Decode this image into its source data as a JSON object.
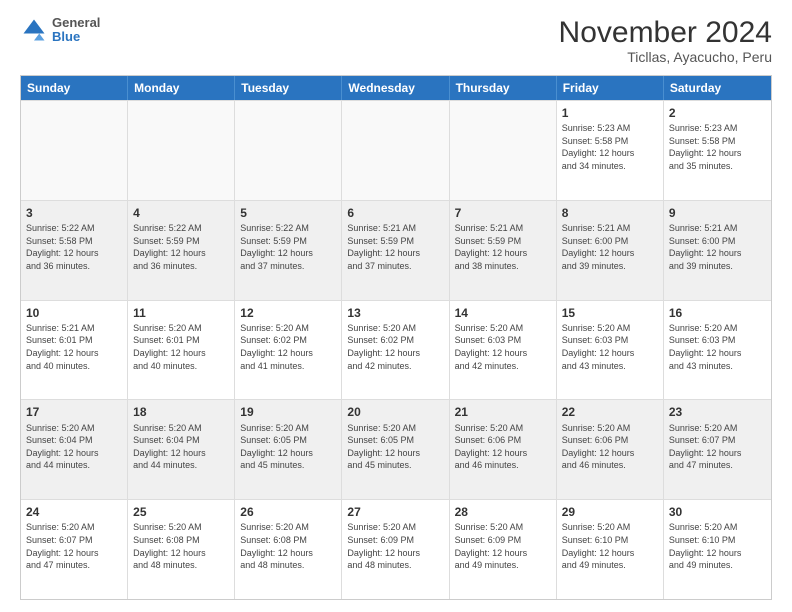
{
  "header": {
    "logo": {
      "line1": "General",
      "line2": "Blue"
    },
    "title": "November 2024",
    "subtitle": "Ticllas, Ayacucho, Peru"
  },
  "calendar": {
    "days": [
      "Sunday",
      "Monday",
      "Tuesday",
      "Wednesday",
      "Thursday",
      "Friday",
      "Saturday"
    ],
    "rows": [
      [
        {
          "day": "",
          "text": ""
        },
        {
          "day": "",
          "text": ""
        },
        {
          "day": "",
          "text": ""
        },
        {
          "day": "",
          "text": ""
        },
        {
          "day": "",
          "text": ""
        },
        {
          "day": "1",
          "text": "Sunrise: 5:23 AM\nSunset: 5:58 PM\nDaylight: 12 hours\nand 34 minutes."
        },
        {
          "day": "2",
          "text": "Sunrise: 5:23 AM\nSunset: 5:58 PM\nDaylight: 12 hours\nand 35 minutes."
        }
      ],
      [
        {
          "day": "3",
          "text": "Sunrise: 5:22 AM\nSunset: 5:58 PM\nDaylight: 12 hours\nand 36 minutes."
        },
        {
          "day": "4",
          "text": "Sunrise: 5:22 AM\nSunset: 5:59 PM\nDaylight: 12 hours\nand 36 minutes."
        },
        {
          "day": "5",
          "text": "Sunrise: 5:22 AM\nSunset: 5:59 PM\nDaylight: 12 hours\nand 37 minutes."
        },
        {
          "day": "6",
          "text": "Sunrise: 5:21 AM\nSunset: 5:59 PM\nDaylight: 12 hours\nand 37 minutes."
        },
        {
          "day": "7",
          "text": "Sunrise: 5:21 AM\nSunset: 5:59 PM\nDaylight: 12 hours\nand 38 minutes."
        },
        {
          "day": "8",
          "text": "Sunrise: 5:21 AM\nSunset: 6:00 PM\nDaylight: 12 hours\nand 39 minutes."
        },
        {
          "day": "9",
          "text": "Sunrise: 5:21 AM\nSunset: 6:00 PM\nDaylight: 12 hours\nand 39 minutes."
        }
      ],
      [
        {
          "day": "10",
          "text": "Sunrise: 5:21 AM\nSunset: 6:01 PM\nDaylight: 12 hours\nand 40 minutes."
        },
        {
          "day": "11",
          "text": "Sunrise: 5:20 AM\nSunset: 6:01 PM\nDaylight: 12 hours\nand 40 minutes."
        },
        {
          "day": "12",
          "text": "Sunrise: 5:20 AM\nSunset: 6:02 PM\nDaylight: 12 hours\nand 41 minutes."
        },
        {
          "day": "13",
          "text": "Sunrise: 5:20 AM\nSunset: 6:02 PM\nDaylight: 12 hours\nand 42 minutes."
        },
        {
          "day": "14",
          "text": "Sunrise: 5:20 AM\nSunset: 6:03 PM\nDaylight: 12 hours\nand 42 minutes."
        },
        {
          "day": "15",
          "text": "Sunrise: 5:20 AM\nSunset: 6:03 PM\nDaylight: 12 hours\nand 43 minutes."
        },
        {
          "day": "16",
          "text": "Sunrise: 5:20 AM\nSunset: 6:03 PM\nDaylight: 12 hours\nand 43 minutes."
        }
      ],
      [
        {
          "day": "17",
          "text": "Sunrise: 5:20 AM\nSunset: 6:04 PM\nDaylight: 12 hours\nand 44 minutes."
        },
        {
          "day": "18",
          "text": "Sunrise: 5:20 AM\nSunset: 6:04 PM\nDaylight: 12 hours\nand 44 minutes."
        },
        {
          "day": "19",
          "text": "Sunrise: 5:20 AM\nSunset: 6:05 PM\nDaylight: 12 hours\nand 45 minutes."
        },
        {
          "day": "20",
          "text": "Sunrise: 5:20 AM\nSunset: 6:05 PM\nDaylight: 12 hours\nand 45 minutes."
        },
        {
          "day": "21",
          "text": "Sunrise: 5:20 AM\nSunset: 6:06 PM\nDaylight: 12 hours\nand 46 minutes."
        },
        {
          "day": "22",
          "text": "Sunrise: 5:20 AM\nSunset: 6:06 PM\nDaylight: 12 hours\nand 46 minutes."
        },
        {
          "day": "23",
          "text": "Sunrise: 5:20 AM\nSunset: 6:07 PM\nDaylight: 12 hours\nand 47 minutes."
        }
      ],
      [
        {
          "day": "24",
          "text": "Sunrise: 5:20 AM\nSunset: 6:07 PM\nDaylight: 12 hours\nand 47 minutes."
        },
        {
          "day": "25",
          "text": "Sunrise: 5:20 AM\nSunset: 6:08 PM\nDaylight: 12 hours\nand 48 minutes."
        },
        {
          "day": "26",
          "text": "Sunrise: 5:20 AM\nSunset: 6:08 PM\nDaylight: 12 hours\nand 48 minutes."
        },
        {
          "day": "27",
          "text": "Sunrise: 5:20 AM\nSunset: 6:09 PM\nDaylight: 12 hours\nand 48 minutes."
        },
        {
          "day": "28",
          "text": "Sunrise: 5:20 AM\nSunset: 6:09 PM\nDaylight: 12 hours\nand 49 minutes."
        },
        {
          "day": "29",
          "text": "Sunrise: 5:20 AM\nSunset: 6:10 PM\nDaylight: 12 hours\nand 49 minutes."
        },
        {
          "day": "30",
          "text": "Sunrise: 5:20 AM\nSunset: 6:10 PM\nDaylight: 12 hours\nand 49 minutes."
        }
      ]
    ]
  }
}
